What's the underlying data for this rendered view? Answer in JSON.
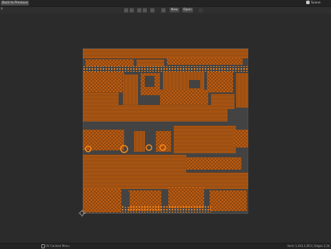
{
  "topbar": {
    "back_button_label": "Back to Previous",
    "scene_label": "Scene"
  },
  "header": {
    "left_label": "V",
    "new_button_label": "New",
    "open_button_label": "Open"
  },
  "statusbar": {
    "left_text": "UV Context Menu",
    "right_text": "Verts 1,443,1,853 | Edges 2,3k"
  },
  "colors": {
    "uv_fill": "#c25f10",
    "uv_edge": "#ff8c1a",
    "uv_canvas": "#434343",
    "background": "#2b2b2b"
  }
}
